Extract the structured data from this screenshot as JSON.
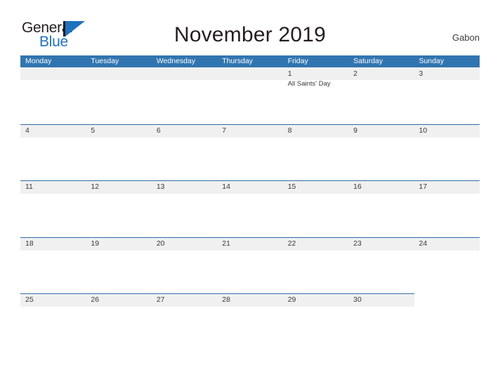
{
  "brand": {
    "name_part1": "General",
    "name_part2": "Blue",
    "flag_icon": "flag-triangle-icon"
  },
  "header": {
    "title": "November 2019",
    "country": "Gabon"
  },
  "calendar": {
    "weekday_headers": [
      "Monday",
      "Tuesday",
      "Wednesday",
      "Thursday",
      "Friday",
      "Saturday",
      "Sunday"
    ],
    "colors": {
      "header_blue": "#3175b0",
      "band_gray": "#f0f0f0",
      "rule_blue": "#2f6fa8",
      "logo_blue": "#1f72bd",
      "text": "#231f20"
    },
    "weeks": [
      {
        "band_columns": 7,
        "days": [
          {
            "date": "",
            "event": ""
          },
          {
            "date": "",
            "event": ""
          },
          {
            "date": "",
            "event": ""
          },
          {
            "date": "",
            "event": ""
          },
          {
            "date": "1",
            "event": "All Saints' Day"
          },
          {
            "date": "2",
            "event": ""
          },
          {
            "date": "3",
            "event": ""
          }
        ]
      },
      {
        "band_columns": 7,
        "days": [
          {
            "date": "4",
            "event": ""
          },
          {
            "date": "5",
            "event": ""
          },
          {
            "date": "6",
            "event": ""
          },
          {
            "date": "7",
            "event": ""
          },
          {
            "date": "8",
            "event": ""
          },
          {
            "date": "9",
            "event": ""
          },
          {
            "date": "10",
            "event": ""
          }
        ]
      },
      {
        "band_columns": 7,
        "days": [
          {
            "date": "11",
            "event": ""
          },
          {
            "date": "12",
            "event": ""
          },
          {
            "date": "13",
            "event": ""
          },
          {
            "date": "14",
            "event": ""
          },
          {
            "date": "15",
            "event": ""
          },
          {
            "date": "16",
            "event": ""
          },
          {
            "date": "17",
            "event": ""
          }
        ]
      },
      {
        "band_columns": 7,
        "days": [
          {
            "date": "18",
            "event": ""
          },
          {
            "date": "19",
            "event": ""
          },
          {
            "date": "20",
            "event": ""
          },
          {
            "date": "21",
            "event": ""
          },
          {
            "date": "22",
            "event": ""
          },
          {
            "date": "23",
            "event": ""
          },
          {
            "date": "24",
            "event": ""
          }
        ]
      },
      {
        "band_columns": 6,
        "days": [
          {
            "date": "25",
            "event": ""
          },
          {
            "date": "26",
            "event": ""
          },
          {
            "date": "27",
            "event": ""
          },
          {
            "date": "28",
            "event": ""
          },
          {
            "date": "29",
            "event": ""
          },
          {
            "date": "30",
            "event": ""
          },
          {
            "date": "",
            "event": ""
          }
        ]
      }
    ]
  }
}
